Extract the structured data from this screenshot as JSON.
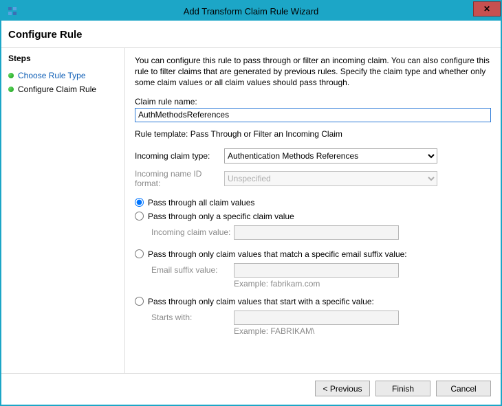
{
  "window": {
    "title": "Add Transform Claim Rule Wizard"
  },
  "header": {
    "title": "Configure Rule"
  },
  "sidebar": {
    "heading": "Steps",
    "items": [
      {
        "label": "Choose Rule Type",
        "link": true
      },
      {
        "label": "Configure Claim Rule",
        "link": false
      }
    ]
  },
  "main": {
    "intro": "You can configure this rule to pass through or filter an incoming claim. You can also configure this rule to filter claims that are generated by previous rules. Specify the claim type and whether only some claim values or all claim values should pass through.",
    "claim_rule_name_label": "Claim rule name:",
    "claim_rule_name_value": "AuthMethodsReferences",
    "rule_template_text": "Rule template: Pass Through or Filter an Incoming Claim",
    "incoming_claim_type_label": "Incoming claim type:",
    "incoming_claim_type_value": "Authentication Methods References",
    "incoming_name_id_label": "Incoming name ID format:",
    "incoming_name_id_value": "Unspecified",
    "radios": {
      "all": "Pass through all claim values",
      "specific": "Pass through only a specific claim value",
      "email_suffix": "Pass through only claim values that match a specific email suffix value:",
      "starts_with": "Pass through only claim values that start with a specific value:"
    },
    "incoming_claim_value_label": "Incoming claim value:",
    "email_suffix_label": "Email suffix value:",
    "email_suffix_example": "Example: fabrikam.com",
    "starts_with_label": "Starts with:",
    "starts_with_example": "Example: FABRIKAM\\"
  },
  "footer": {
    "previous": "< Previous",
    "finish": "Finish",
    "cancel": "Cancel"
  }
}
